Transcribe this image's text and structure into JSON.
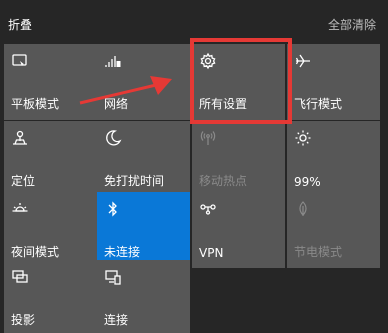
{
  "header": {
    "collapse_label": "折叠",
    "clear_all_label": "全部清除"
  },
  "tiles": [
    {
      "label": "平板模式",
      "icon": "tablet-mode-icon",
      "state": "off"
    },
    {
      "label": "网络",
      "icon": "network-icon",
      "state": "off"
    },
    {
      "label": "所有设置",
      "icon": "gear-icon",
      "state": "off"
    },
    {
      "label": "飞行模式",
      "icon": "airplane-icon",
      "state": "off"
    },
    {
      "label": "定位",
      "icon": "location-icon",
      "state": "off"
    },
    {
      "label": "免打扰时间",
      "icon": "moon-icon",
      "state": "off"
    },
    {
      "label": "移动热点",
      "icon": "hotspot-icon",
      "state": "disabled"
    },
    {
      "label": "99%",
      "icon": "brightness-icon",
      "state": "off"
    },
    {
      "label": "夜间模式",
      "icon": "night-light-icon",
      "state": "off"
    },
    {
      "label": "未连接",
      "icon": "bluetooth-icon",
      "state": "on"
    },
    {
      "label": "VPN",
      "icon": "vpn-icon",
      "state": "off"
    },
    {
      "label": "节电模式",
      "icon": "battery-saver-icon",
      "state": "disabled"
    },
    {
      "label": "投影",
      "icon": "project-icon",
      "state": "off"
    },
    {
      "label": "连接",
      "icon": "connect-icon",
      "state": "off"
    }
  ],
  "colors": {
    "tile_bg": "#575757",
    "tile_active_bg": "#0a78d7",
    "highlight": "#e53935"
  }
}
